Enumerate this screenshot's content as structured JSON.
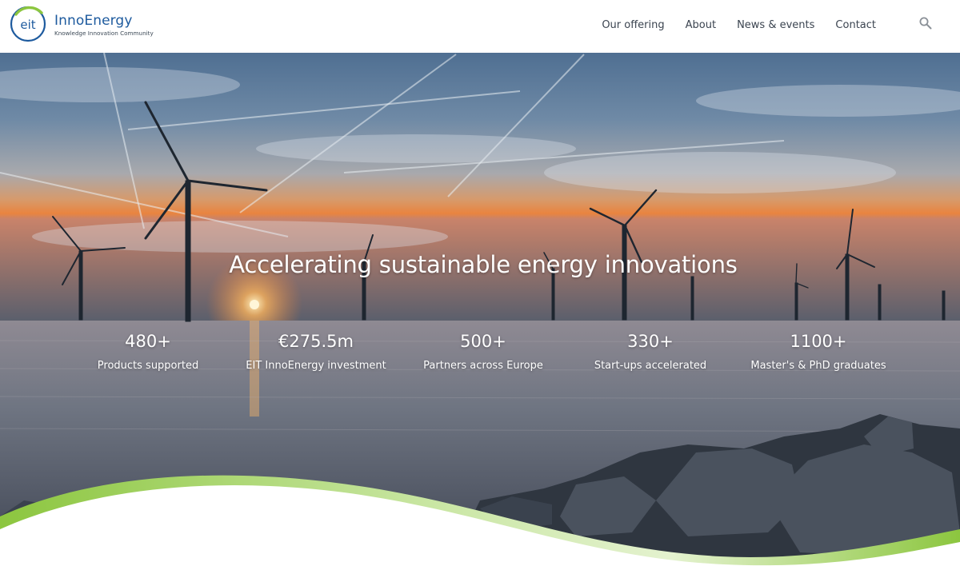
{
  "logo": {
    "mark_text": "eit",
    "name": "InnoEnergy",
    "tagline": "Knowledge Innovation Community",
    "colors": {
      "blue": "#1d5a9e",
      "green": "#8cc63f"
    }
  },
  "nav": {
    "items": [
      {
        "label": "Our offering"
      },
      {
        "label": "About"
      },
      {
        "label": "News & events"
      },
      {
        "label": "Contact"
      }
    ],
    "search_icon": "search-icon"
  },
  "hero": {
    "title": "Accelerating sustainable energy innovations",
    "stats": [
      {
        "value": "480+",
        "label": "Products supported"
      },
      {
        "value": "€275.5m",
        "label": "EIT InnoEnergy investment"
      },
      {
        "value": "500+",
        "label": "Partners across Europe"
      },
      {
        "value": "330+",
        "label": "Start-ups accelerated"
      },
      {
        "value": "1100+",
        "label": "Master's & PhD graduates"
      }
    ],
    "accent_color": "#8cc63f"
  }
}
